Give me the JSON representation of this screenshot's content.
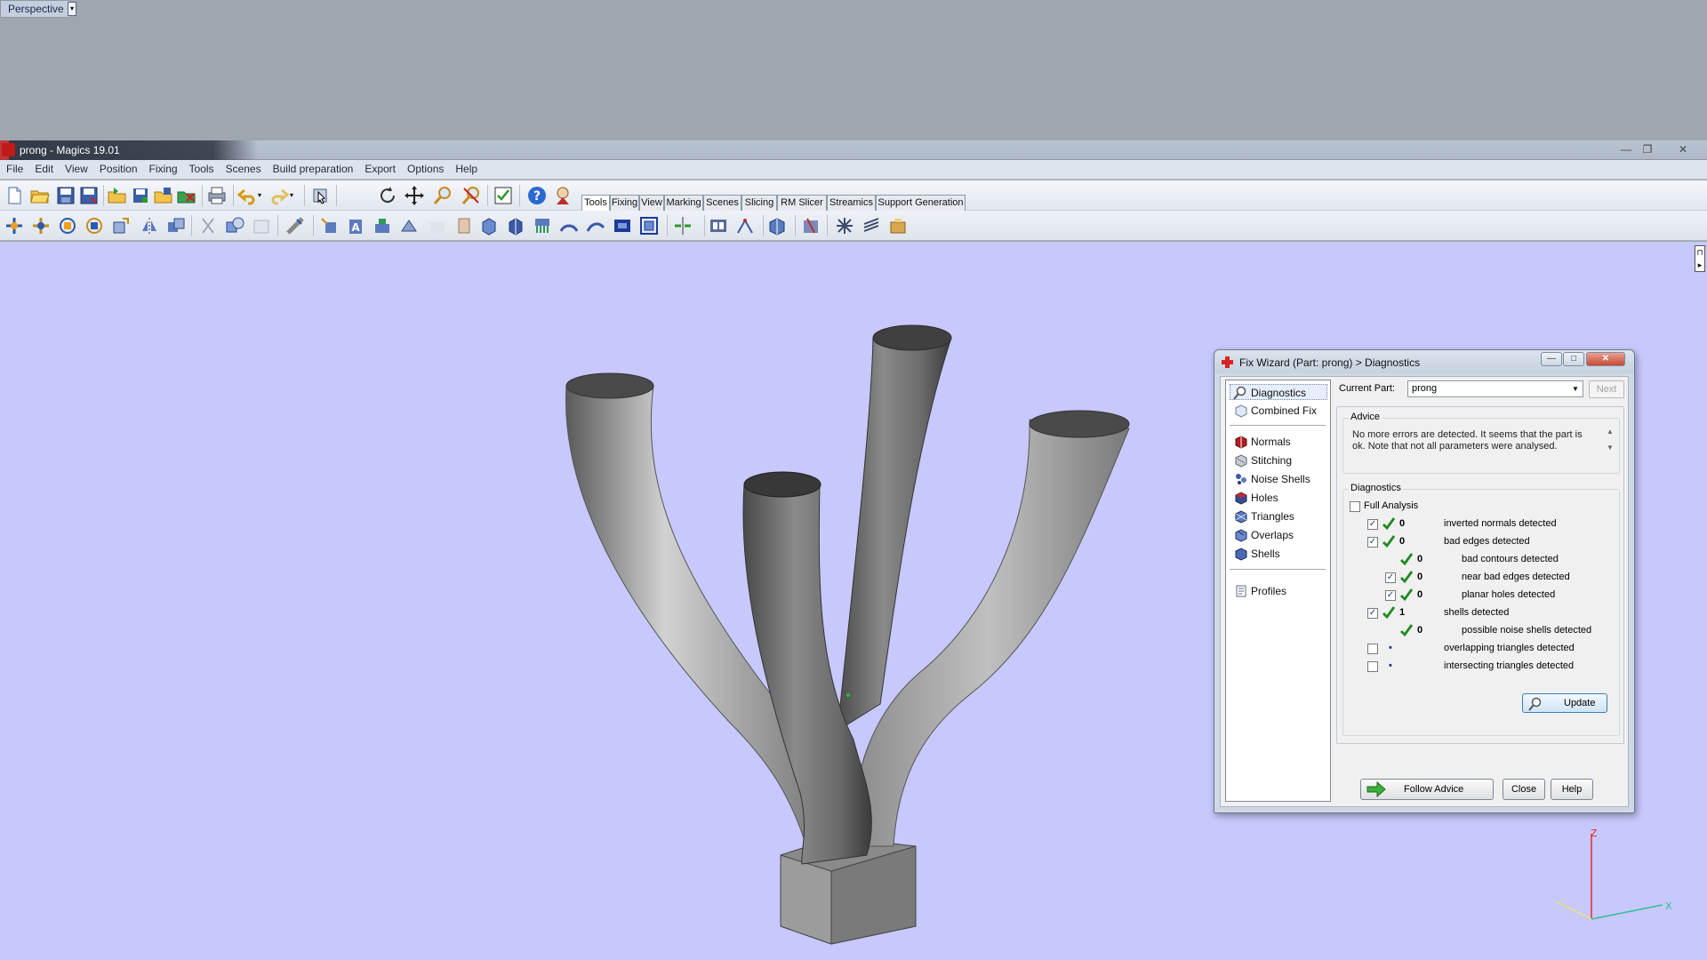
{
  "viewport_top": {
    "view_label": "Perspective"
  },
  "app": {
    "title": "prong - Magics 19.01"
  },
  "window_controls": {
    "minimize": "—",
    "restore": "❐",
    "close": "✕"
  },
  "menu": [
    "File",
    "Edit",
    "View",
    "Position",
    "Fixing",
    "Tools",
    "Scenes",
    "Build preparation",
    "Export",
    "Options",
    "Help"
  ],
  "tabs": [
    "Tools",
    "Fixing",
    "View",
    "Marking",
    "Scenes",
    "Slicing",
    "RM Slicer",
    "Streamics",
    "Support Generation"
  ],
  "active_tab": "Tools",
  "axis": {
    "z_label": "Z",
    "x_label": "X"
  },
  "fix_wizard": {
    "title": "Fix Wizard (Part: prong) > Diagnostics",
    "nav": {
      "top": [
        "Diagnostics",
        "Combined Fix"
      ],
      "tools": [
        "Normals",
        "Stitching",
        "Noise Shells",
        "Holes",
        "Triangles",
        "Overlaps",
        "Shells"
      ],
      "bottom": [
        "Profiles"
      ]
    },
    "current_part_label": "Current Part:",
    "current_part_value": "prong",
    "next_label": "Next",
    "advice_title": "Advice",
    "advice_text": "No more errors are detected. It seems that the part is ok. Note that not all parameters were analysed.",
    "diagnostics_title": "Diagnostics",
    "full_analysis_label": "Full Analysis",
    "rows": [
      {
        "checked": true,
        "status": "ok",
        "count": "0",
        "label": "inverted normals detected",
        "indent": 0
      },
      {
        "checked": true,
        "status": "ok",
        "count": "0",
        "label": "bad edges detected",
        "indent": 0
      },
      {
        "checked": null,
        "status": "ok",
        "count": "0",
        "label": "bad contours detected",
        "indent": 1
      },
      {
        "checked": true,
        "status": "ok",
        "count": "0",
        "label": "near bad edges detected",
        "indent": 1
      },
      {
        "checked": true,
        "status": "ok",
        "count": "0",
        "label": "planar holes detected",
        "indent": 1
      },
      {
        "checked": true,
        "status": "ok",
        "count": "1",
        "label": "shells detected",
        "indent": 0
      },
      {
        "checked": null,
        "status": "ok",
        "count": "0",
        "label": "possible noise shells detected",
        "indent": 1
      },
      {
        "checked": false,
        "status": "none",
        "count": "•",
        "label": "overlapping triangles detected",
        "indent": 0
      },
      {
        "checked": false,
        "status": "none",
        "count": "•",
        "label": "intersecting triangles detected",
        "indent": 0
      }
    ],
    "update_label": "Update",
    "follow_advice_label": "Follow Advice",
    "close_label": "Close",
    "help_label": "Help"
  }
}
